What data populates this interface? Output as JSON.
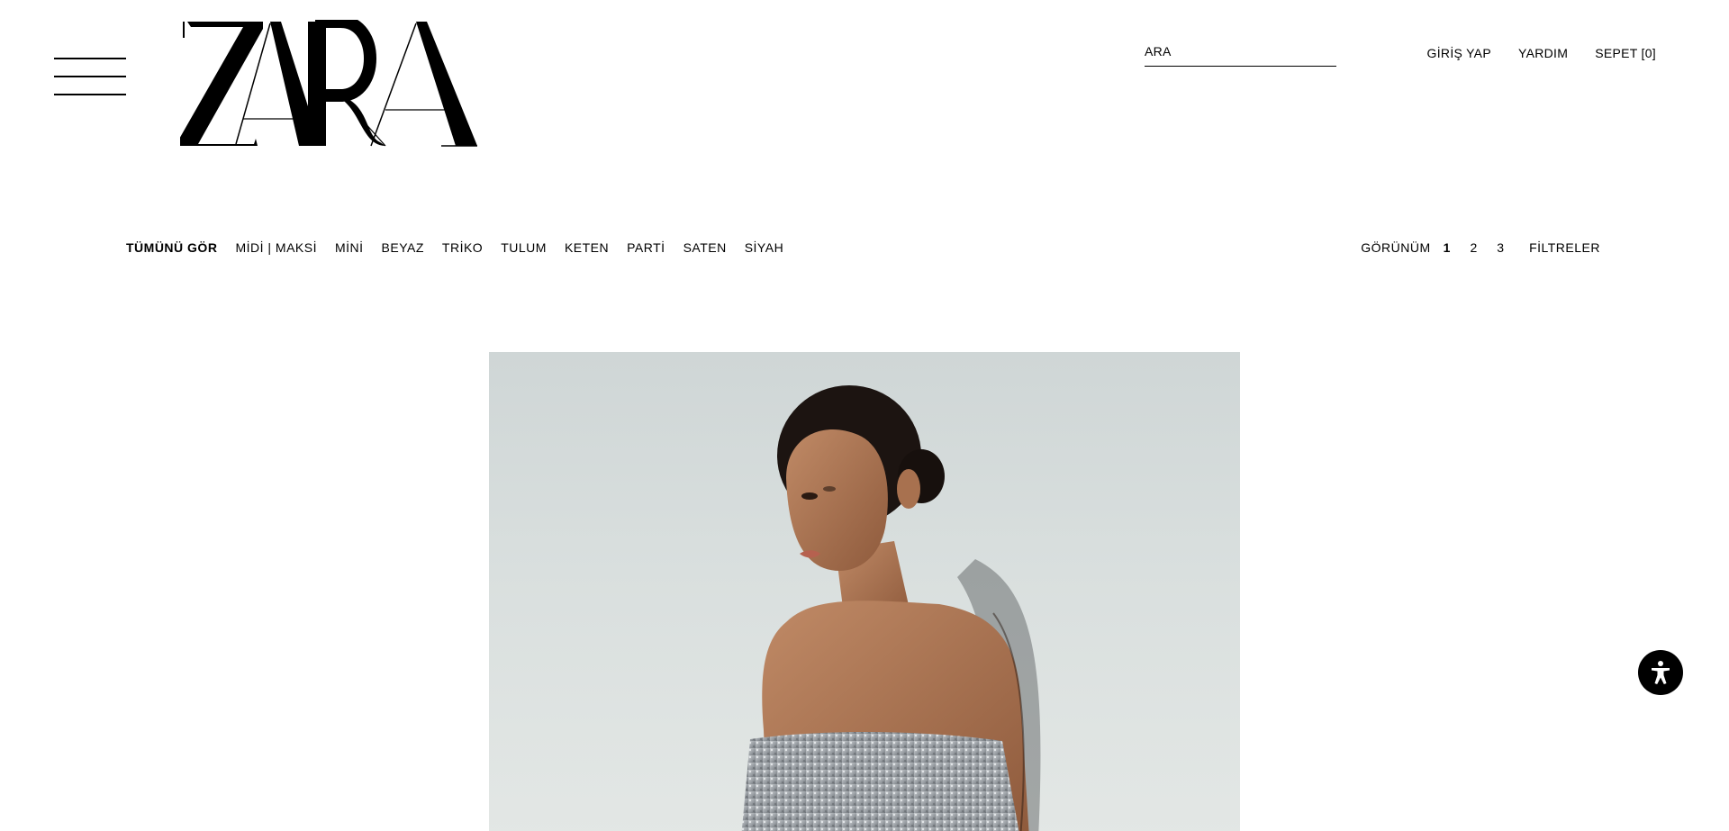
{
  "header": {
    "menu_icon": "hamburger-menu-icon",
    "logo_text": "ZARA",
    "search": {
      "placeholder": "ARA",
      "value": ""
    },
    "links": [
      {
        "label": "GİRİŞ YAP"
      },
      {
        "label": "YARDIM"
      },
      {
        "label": "SEPET [0]"
      }
    ]
  },
  "categories": {
    "items": [
      {
        "label": "TÜMÜNÜ GÖR",
        "active": true
      },
      {
        "label": "MİDİ | MAKSİ"
      },
      {
        "label": "MİNİ"
      },
      {
        "label": "BEYAZ"
      },
      {
        "label": "TRİKO"
      },
      {
        "label": "TULUM"
      },
      {
        "label": "KETEN"
      },
      {
        "label": "PARTİ"
      },
      {
        "label": "SATEN"
      },
      {
        "label": "SİYAH"
      }
    ]
  },
  "view": {
    "label": "GÖRÜNÜM",
    "options": [
      "1",
      "2",
      "3"
    ],
    "selected": "1",
    "filters_label": "FİLTRELER"
  },
  "product": {
    "image_icon": "product-photo"
  },
  "accessibility": {
    "icon": "accessibility-icon"
  },
  "colors": {
    "text": "#000000",
    "background": "#ffffff",
    "photo_background": "#d6dcdc"
  }
}
